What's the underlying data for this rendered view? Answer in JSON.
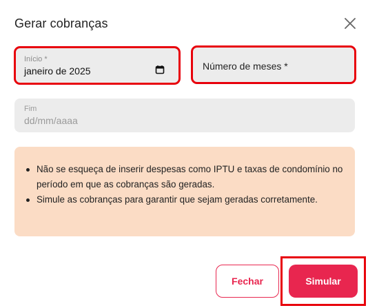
{
  "dialog": {
    "title": "Gerar cobranças",
    "close_icon": "close-icon"
  },
  "fields": {
    "start": {
      "label": "Início *",
      "value": "janeiro de 2025",
      "icon": "calendar-icon"
    },
    "months": {
      "label": "Número de meses *"
    },
    "end": {
      "label": "Fim",
      "placeholder": "dd/mm/aaaa"
    }
  },
  "notice": {
    "items": [
      "Não se esqueça de inserir despesas como IPTU e taxas de condomínio no período em que as cobranças são geradas.",
      "Simule as cobranças para garantir que sejam geradas corretamente."
    ]
  },
  "buttons": {
    "close_label": "Fechar",
    "simulate_label": "Simular"
  },
  "colors": {
    "accent": "#e8264f",
    "notice_bg": "#fbdcc5",
    "field_bg": "#ececec",
    "highlight": "#e8000b"
  }
}
